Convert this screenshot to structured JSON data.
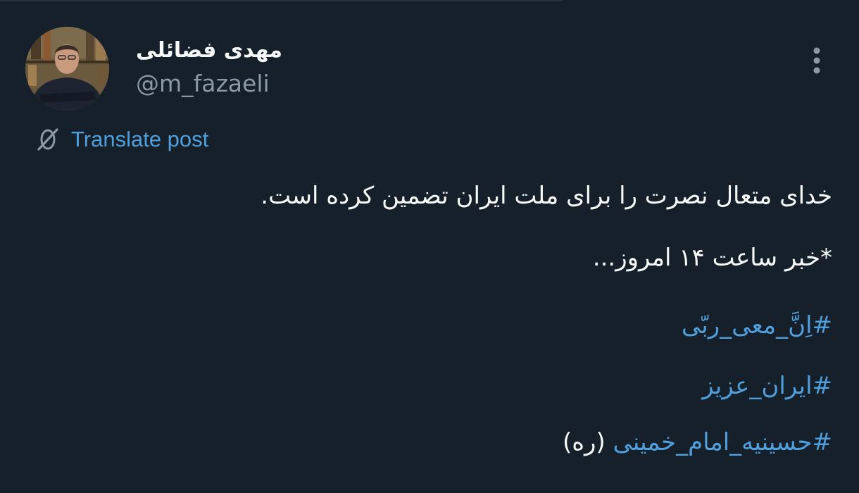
{
  "author": {
    "display_name": "مهدی فضائلی",
    "handle": "@m_fazaeli",
    "avatar_icon": "profile-photo"
  },
  "menu": {
    "more_icon": "vertical-ellipsis-icon"
  },
  "translate": {
    "label": "Translate post",
    "icon": "translate-slash-globe-icon"
  },
  "post": {
    "line1": "خدای متعال نصرت را برای ملت ایران تضمین کرده است.",
    "line2": "*خبر ساعت ۱۴ امروز...",
    "hashtags": [
      "#اِنَّ_معی_ربّی",
      "#ایران_عزیز",
      "#حسینیه_امام_خمینی"
    ],
    "last_suffix": "(ره)"
  },
  "colors": {
    "background": "#16202b",
    "text": "#f7f9f9",
    "secondary": "#8b98a5",
    "link": "#4f9fdc"
  }
}
